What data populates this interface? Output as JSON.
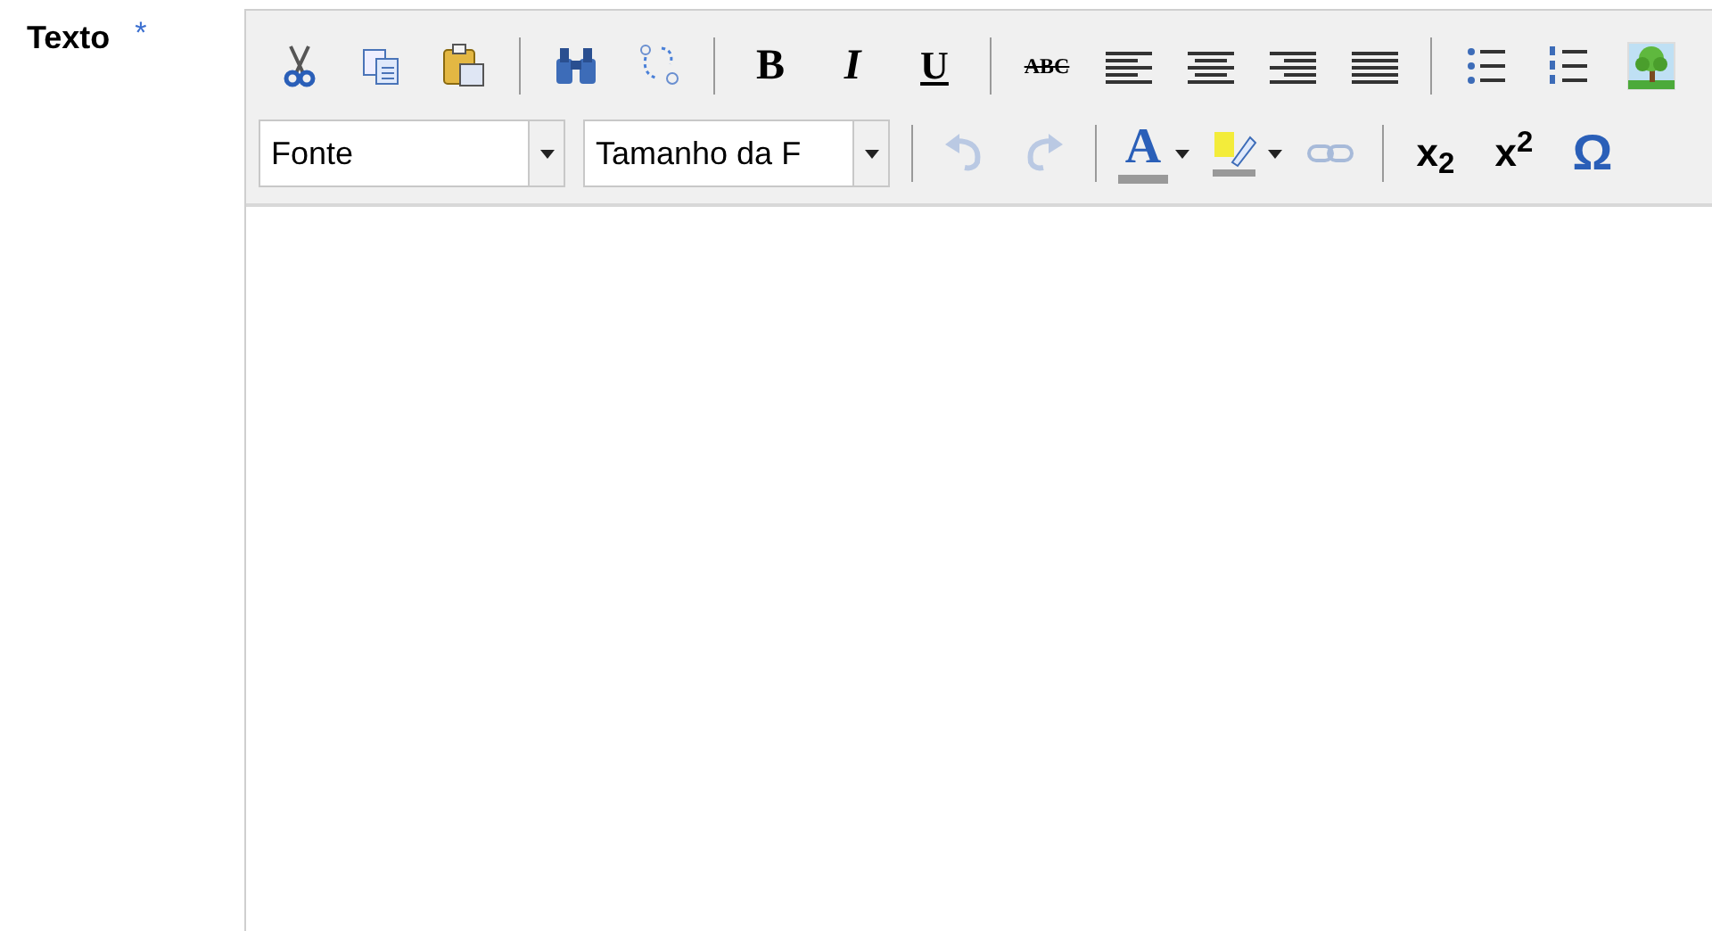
{
  "field": {
    "label": "Texto",
    "required_mark": "*"
  },
  "toolbar": {
    "row_1": [
      {
        "kind": "cut",
        "disabled": false
      },
      {
        "kind": "copy",
        "disabled": false
      },
      {
        "kind": "paste",
        "disabled": false
      },
      {
        "kind": "separator"
      },
      {
        "kind": "find",
        "disabled": false
      },
      {
        "kind": "replace",
        "disabled": false
      },
      {
        "kind": "separator"
      },
      {
        "kind": "bold",
        "label": "B",
        "disabled": false
      },
      {
        "kind": "italic",
        "label": "I",
        "disabled": false
      },
      {
        "kind": "underline",
        "label": "U",
        "disabled": false
      },
      {
        "kind": "separator"
      },
      {
        "kind": "strike",
        "label": "ABC",
        "disabled": false
      },
      {
        "kind": "align-left",
        "disabled": false
      },
      {
        "kind": "align-center",
        "disabled": false
      },
      {
        "kind": "align-right",
        "disabled": false
      },
      {
        "kind": "justify",
        "disabled": false
      },
      {
        "kind": "separator"
      },
      {
        "kind": "bullets",
        "disabled": false
      },
      {
        "kind": "numbers",
        "disabled": false
      },
      {
        "kind": "image",
        "disabled": false
      }
    ],
    "row_2": [
      {
        "kind": "select",
        "value": "Fonte"
      },
      {
        "kind": "select",
        "value": "Tamanho da F"
      },
      {
        "kind": "separator"
      },
      {
        "kind": "undo",
        "disabled": true
      },
      {
        "kind": "redo",
        "disabled": true
      },
      {
        "kind": "separator"
      },
      {
        "kind": "text-color",
        "label": "A",
        "disabled": false
      },
      {
        "kind": "highlight",
        "disabled": false
      },
      {
        "kind": "link",
        "disabled": true
      },
      {
        "kind": "separator"
      },
      {
        "kind": "subscript",
        "label": "x$_{2}$",
        "disabled": false
      },
      {
        "kind": "superscript",
        "label": "x$^{2}$",
        "disabled": false
      },
      {
        "kind": "special-char",
        "label": "Ω",
        "disabled": false
      }
    ]
  }
}
